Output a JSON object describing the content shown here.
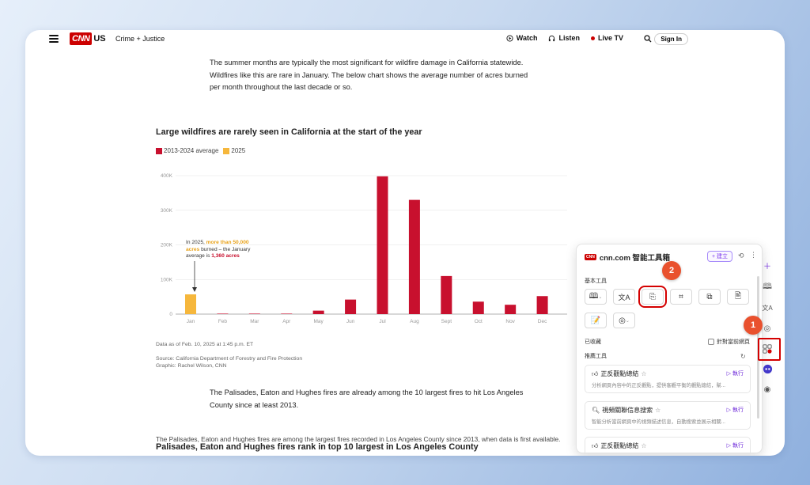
{
  "nav": {
    "logo": "CNN",
    "logo_suffix": "US",
    "section": "Crime + Justice",
    "watch": "Watch",
    "listen": "Listen",
    "live_tv": "Live TV",
    "sign_in": "Sign In"
  },
  "article": {
    "intro": "The summer months are typically the most significant for wildfire damage in California statewide. Wildfires like this are rare in January. The below chart shows the average number of acres burned per month throughout the last decade or so.",
    "chart_title": "Large wildfires are rarely seen in California at the start of the year",
    "legend_avg": "2013-2024 average",
    "legend_2025": "2025",
    "annotation": {
      "line1": "In 2025, ",
      "hl1": "more than 50,000",
      "hl2": "acres",
      "line2": " burned – the January",
      "line3": "average is ",
      "hl3": "1,360 acres"
    },
    "data_note": "Data as of Feb. 10, 2025 at 1:45 p.m. ET",
    "source": "Source: California Department of Forestry and Fire Protection",
    "graphic": "Graphic: Rachel Wilson, CNN",
    "para2": "The Palisades, Eaton and Hughes fires are already among the 10 largest fires to hit Los Angeles County since at least 2013.",
    "heading2": "Palisades, Eaton and Hughes fires rank in top 10 largest in Los Angeles County",
    "para3": "The Palisades, Eaton and Hughes fires are among the largest fires recorded in Los Angeles County since 2013, when data is first available."
  },
  "chart_data": {
    "type": "bar",
    "title": "Large wildfires are rarely seen in California at the start of the year",
    "categories": [
      "Jan",
      "Feb",
      "Mar",
      "Apr",
      "May",
      "Jun",
      "Jul",
      "Aug",
      "Sept",
      "Oct",
      "Nov",
      "Dec"
    ],
    "series": [
      {
        "name": "2013-2024 average",
        "color": "#c8102e",
        "values": [
          1360,
          300,
          500,
          700,
          10000,
          42000,
          398000,
          330000,
          110000,
          36000,
          27000,
          52000
        ]
      },
      {
        "name": "2025",
        "color": "#f6b73c",
        "values": [
          57000,
          null,
          null,
          null,
          null,
          null,
          null,
          null,
          null,
          null,
          null,
          null
        ]
      }
    ],
    "y_ticks": [
      "0",
      "100K",
      "200K",
      "300K",
      "400K"
    ],
    "ylim": [
      0,
      400000
    ],
    "grid": true
  },
  "popup": {
    "title": "cnn.com 智能工具箱",
    "site_tag": "CNN",
    "new_btn": "+ 建立",
    "basic_tools": "基本工具",
    "saved": "已收藏",
    "current_page": "針對當前網頁",
    "recommended": "推薦工具",
    "cards": [
      {
        "title": "正反觀點總結",
        "run": "執行",
        "desc": "分析網頁內容中的正反觀點，提供客觀平衡的觀點總結，幫..."
      },
      {
        "title": "視頻關聯信息搜索",
        "run": "執行",
        "desc": "智能分析當前網頁中的視頻描述信息，自動搜索並展示相關..."
      },
      {
        "title": "正反觀點總結",
        "run": "執行",
        "desc": ""
      }
    ]
  },
  "badges": {
    "one": "1",
    "two": "2"
  },
  "colors": {
    "highlight": "#d40000",
    "badge": "#e9512e",
    "accent": "#7c3aed",
    "cnn_red": "#cc0000"
  }
}
